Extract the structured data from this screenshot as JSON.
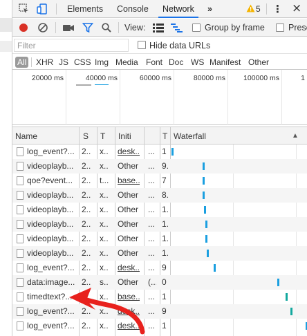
{
  "devtools": {
    "tabs": [
      "Elements",
      "Console",
      "Network"
    ],
    "active_tab": "Network",
    "more_tabs": "»",
    "warning_count": "5",
    "more_menu": "⋮",
    "close": "×"
  },
  "toolbar": {
    "view_label": "View:",
    "group_by_frame": "Group by frame",
    "preserve_log": "Prese"
  },
  "filter": {
    "placeholder": "Filter",
    "hide_data_urls": "Hide data URLs"
  },
  "type_filters": [
    "All",
    "XHR",
    "JS",
    "CSS",
    "Img",
    "Media",
    "Font",
    "Doc",
    "WS",
    "Manifest",
    "Other"
  ],
  "overview": {
    "ticks": [
      "20000 ms",
      "40000 ms",
      "60000 ms",
      "80000 ms",
      "100000 ms",
      "1"
    ]
  },
  "table": {
    "columns": [
      "Name",
      "S",
      "T",
      "Initi",
      "",
      "T",
      "Waterfall"
    ],
    "sort_indicator": "▲",
    "rows": [
      {
        "name": "log_event?...",
        "status": "2...",
        "type": "x...",
        "initiator": "desk...",
        "size": "...",
        "time": "1",
        "link": true,
        "wf": 0.0,
        "wf_color": "#1a9fe0"
      },
      {
        "name": "videoplayb...",
        "status": "2...",
        "type": "x...",
        "initiator": "Other",
        "size": "...",
        "time": "9.",
        "link": false,
        "wf": 0.23,
        "wf_color": "#1a9fe0"
      },
      {
        "name": "qoe?event...",
        "status": "2...",
        "type": "t...",
        "initiator": "base...",
        "size": "...",
        "time": "7",
        "link": true,
        "wf": 0.23,
        "wf_color": "#1a9fe0"
      },
      {
        "name": "videoplayb...",
        "status": "2...",
        "type": "x...",
        "initiator": "Other",
        "size": "...",
        "time": "8.",
        "link": false,
        "wf": 0.23,
        "wf_color": "#1a9fe0"
      },
      {
        "name": "videoplayb...",
        "status": "2...",
        "type": "x...",
        "initiator": "Other",
        "size": "...",
        "time": "1.",
        "link": false,
        "wf": 0.24,
        "wf_color": "#1a9fe0"
      },
      {
        "name": "videoplayb...",
        "status": "2...",
        "type": "x...",
        "initiator": "Other",
        "size": "...",
        "time": "1.",
        "link": false,
        "wf": 0.25,
        "wf_color": "#1a9fe0"
      },
      {
        "name": "videoplayb...",
        "status": "2...",
        "type": "x...",
        "initiator": "Other",
        "size": "...",
        "time": "1.",
        "link": false,
        "wf": 0.25,
        "wf_color": "#1a9fe0"
      },
      {
        "name": "videoplayb...",
        "status": "2...",
        "type": "x...",
        "initiator": "Other",
        "size": "...",
        "time": "1.",
        "link": false,
        "wf": 0.26,
        "wf_color": "#1a9fe0"
      },
      {
        "name": "log_event?...",
        "status": "2...",
        "type": "x...",
        "initiator": "desk...",
        "size": "...",
        "time": "9",
        "link": true,
        "wf": 0.31,
        "wf_color": "#1a9fe0"
      },
      {
        "name": "data:image...",
        "status": "2...",
        "type": "s...",
        "initiator": "Other",
        "size": "(...",
        "time": "0",
        "link": false,
        "wf": 0.78,
        "wf_color": "#1a9fe0"
      },
      {
        "name": "timedtext?...",
        "status": "2...",
        "type": "x...",
        "initiator": "base...",
        "size": "...",
        "time": "1",
        "link": true,
        "wf": 0.84,
        "wf_color": "#13a89e"
      },
      {
        "name": "log_event?...",
        "status": "2...",
        "type": "x...",
        "initiator": "desk...",
        "size": "...",
        "time": "9",
        "link": true,
        "wf": 0.88,
        "wf_color": "#13a89e"
      },
      {
        "name": "log_event?...",
        "status": "2...",
        "type": "x...",
        "initiator": "desk...",
        "size": "...",
        "time": "1",
        "link": true,
        "wf": 0.99,
        "wf_color": "#1a9fe0"
      }
    ]
  },
  "colors": {
    "record": "#d93025",
    "accent": "#1a73e8",
    "annotation_arrow": "#e8211d"
  }
}
